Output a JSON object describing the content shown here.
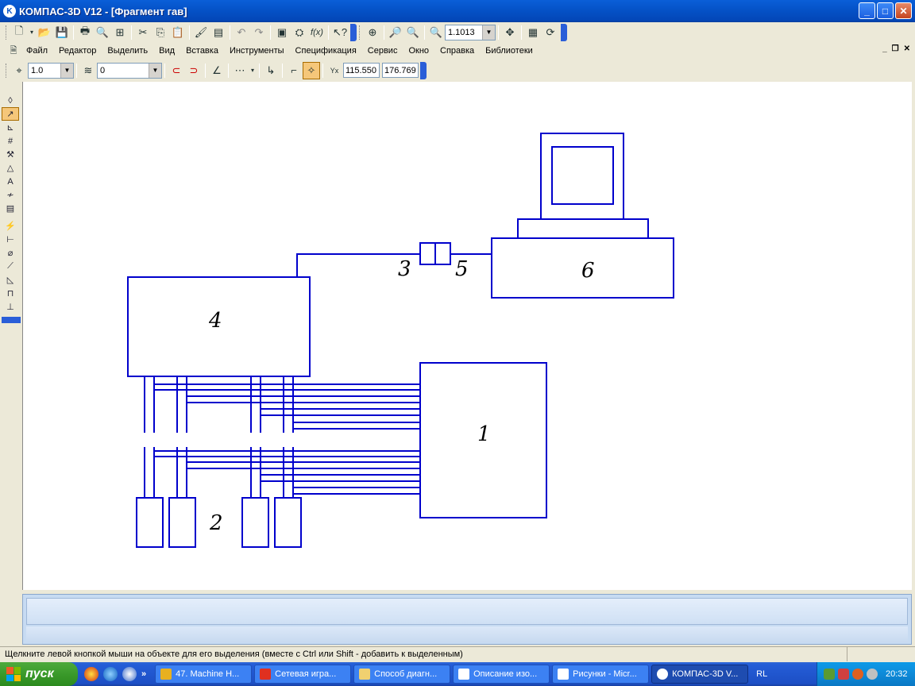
{
  "window": {
    "title": "КОМПАС-3D V12 - [Фрагмент гав]",
    "controls": {
      "minimize": "_",
      "maximize": "□",
      "close": "✕"
    }
  },
  "toolbar_standard": {
    "scale_value": "1.1013"
  },
  "menubar": {
    "items": [
      "Файл",
      "Редактор",
      "Выделить",
      "Вид",
      "Вставка",
      "Инструменты",
      "Спецификация",
      "Сервис",
      "Окно",
      "Справка",
      "Библиотеки"
    ],
    "mdi": {
      "minimize": "_",
      "restore": "❐",
      "close": "✕"
    }
  },
  "toolbar_current_state": {
    "step_value": "1.0",
    "layer_value": "0",
    "x_coord": "115.550",
    "y_coord": "176.769"
  },
  "drawing": {
    "labels": [
      "1",
      "2",
      "3",
      "4",
      "5",
      "6"
    ],
    "line_color": "#0000cc"
  },
  "statusbar": {
    "hint": "Щелкните левой кнопкой мыши на объекте для его выделения (вместе с Ctrl или Shift - добавить к выделенным)"
  },
  "taskbar": {
    "start_label": "пуск",
    "chevron": "»",
    "tasks": [
      {
        "label": "47. Machine H...",
        "color": "#e8b020"
      },
      {
        "label": "Сетевая игра...",
        "color": "#e03020"
      },
      {
        "label": "Способ диагн...",
        "color": "#f0d070"
      },
      {
        "label": "Описание изо...",
        "color": "#2a5fc0"
      },
      {
        "label": "Рисунки - Micr...",
        "color": "#2a5fc0"
      },
      {
        "label": "КОМПАС-3D V...",
        "color": "#ffffff"
      }
    ],
    "language": "RL",
    "clock": "20:32"
  }
}
